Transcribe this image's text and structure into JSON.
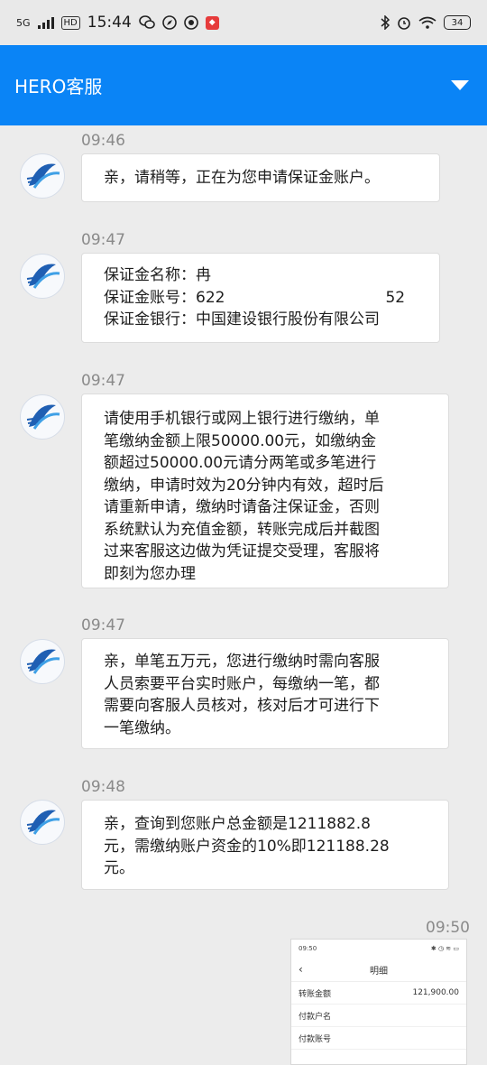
{
  "status_bar": {
    "time": "15:44",
    "network": "5G",
    "hd": "HD",
    "battery": "34"
  },
  "header": {
    "title": "HERO客服"
  },
  "messages": [
    {
      "time": "09:46",
      "text": "亲，请稍等，正在为您申请保证金账户。"
    },
    {
      "time": "09:47",
      "fields": [
        {
          "label": "保证金名称：",
          "value": "冉"
        },
        {
          "label": "保证金账号：",
          "value_start": "622",
          "value_end": "52"
        },
        {
          "label": "保证金银行：",
          "value": "中国建设银行股份有限公司"
        }
      ]
    },
    {
      "time": "09:47",
      "lines": [
        "请使用手机银行或网上银行进行缴纳，单",
        "笔缴纳金额上限50000.00元，如缴纳金",
        "额超过50000.00元请分两笔或多笔进行",
        "缴纳，申请时效为20分钟内有效，超时后",
        "请重新申请，缴纳时请备注保证金，否则",
        "系统默认为充值金额，转账完成后并截图",
        "过来客服这边做为凭证提交受理，客服将",
        "即刻为您办理"
      ]
    },
    {
      "time": "09:47",
      "lines": [
        "亲，单笔五万元，您进行缴纳时需向客服",
        "人员索要平台实时账户，每缴纳一笔，都",
        "需要向客服人员核对，核对后才可进行下",
        "一笔缴纳。"
      ]
    },
    {
      "time": "09:48",
      "lines": [
        "亲，查询到您账户总金额是1211882.8",
        "元，需缴纳账户资金的10%即121188.28",
        "元。"
      ]
    }
  ],
  "image_message": {
    "time": "09:50",
    "status_time": "09:50",
    "nav_title": "明细",
    "rows": [
      {
        "label": "转账金额",
        "value": "121,900.00"
      },
      {
        "label": "付款户名",
        "value": ""
      },
      {
        "label": "付款账号",
        "value": ""
      }
    ]
  },
  "colors": {
    "header_bg": "#0a84f6",
    "page_bg": "#ececec",
    "bubble_bg": "#ffffff"
  }
}
